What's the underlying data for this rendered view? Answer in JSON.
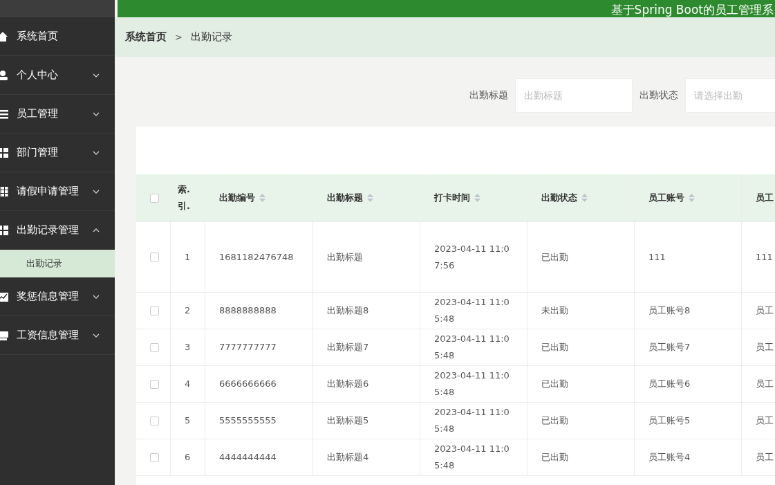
{
  "header": {
    "title": "基于Spring Boot的员工管理系"
  },
  "sidebar": {
    "items": [
      {
        "label": "系统首页",
        "kind": "home"
      },
      {
        "label": "个人中心",
        "kind": "user",
        "expanded": false
      },
      {
        "label": "员工管理",
        "kind": "list",
        "expanded": false
      },
      {
        "label": "部门管理",
        "kind": "grid",
        "expanded": false
      },
      {
        "label": "请假申请管理",
        "kind": "table",
        "expanded": false
      },
      {
        "label": "出勤记录管理",
        "kind": "grid",
        "expanded": true,
        "children": [
          {
            "label": "出勤记录",
            "selected": true
          }
        ]
      },
      {
        "label": "奖惩信息管理",
        "kind": "chart",
        "expanded": false
      },
      {
        "label": "工资信息管理",
        "kind": "box",
        "expanded": false
      }
    ]
  },
  "breadcrumb": [
    "系统首页",
    "出勤记录"
  ],
  "breadcrumb_separator": ">",
  "search": [
    {
      "label": "出勤标题",
      "placeholder": "出勤标题"
    },
    {
      "label": "出勤状态",
      "placeholder": "请选择出勤"
    }
  ],
  "table": {
    "all_checked": false,
    "columns": [
      {
        "label": "索.引.",
        "kind": "plain"
      },
      {
        "label": "出勤编号",
        "kind": "sortable"
      },
      {
        "label": "出勤标题",
        "kind": "sortable"
      },
      {
        "label": "打卡时间",
        "kind": "sortable"
      },
      {
        "label": "出勤状态",
        "kind": "sortable"
      },
      {
        "label": "员工账号",
        "kind": "sortable"
      },
      {
        "label": "员工",
        "kind": "plain"
      }
    ],
    "rows": [
      {
        "checked": false,
        "cells": [
          "1",
          "1681182476748",
          "出勤标题",
          "2023-04-11 11:07:56",
          "已出勤",
          "111",
          "111"
        ]
      },
      {
        "checked": false,
        "cells": [
          "2",
          "8888888888",
          "出勤标题8",
          "2023-04-11 11:05:48",
          "未出勤",
          "员工账号8",
          "员工"
        ]
      },
      {
        "checked": false,
        "cells": [
          "3",
          "7777777777",
          "出勤标题7",
          "2023-04-11 11:05:48",
          "已出勤",
          "员工账号7",
          "员工"
        ]
      },
      {
        "checked": false,
        "cells": [
          "4",
          "6666666666",
          "出勤标题6",
          "2023-04-11 11:05:48",
          "已出勤",
          "员工账号6",
          "员工"
        ]
      },
      {
        "checked": false,
        "cells": [
          "5",
          "5555555555",
          "出勤标题5",
          "2023-04-11 11:05:48",
          "已出勤",
          "员工账号5",
          "员工"
        ]
      },
      {
        "checked": false,
        "cells": [
          "6",
          "4444444444",
          "出勤标题4",
          "2023-04-11 11:05:48",
          "已出勤",
          "员工账号4",
          "员工"
        ]
      }
    ]
  }
}
